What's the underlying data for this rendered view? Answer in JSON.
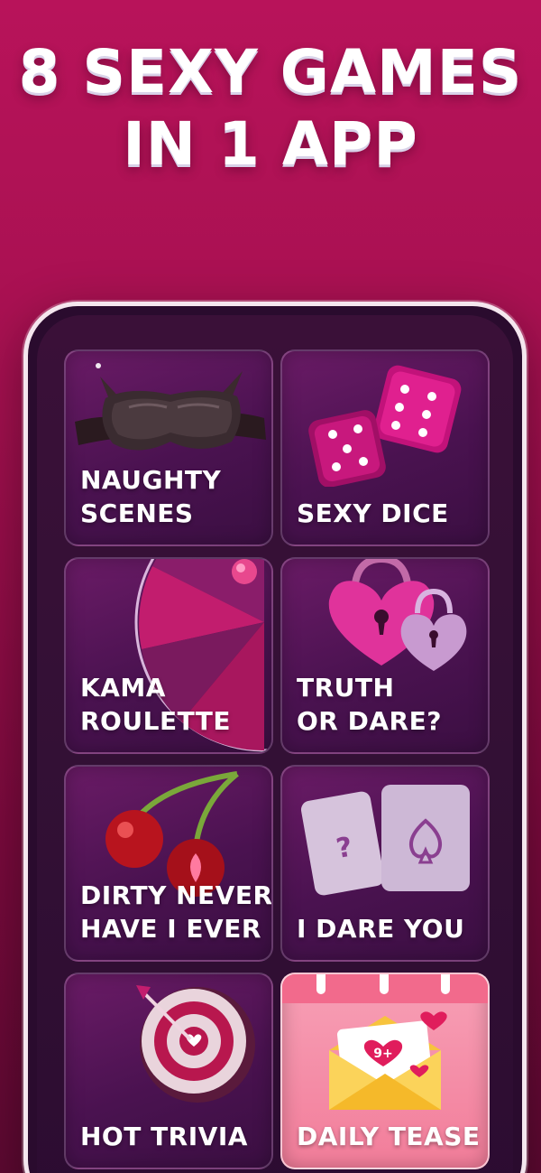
{
  "headline": {
    "line1": "8 SEXY GAMES",
    "line2": "IN 1 APP"
  },
  "games": [
    {
      "line1": "NAUGHTY",
      "line2": "SCENES",
      "icon": "sleep-mask-icon"
    },
    {
      "line1": "",
      "line2": "SEXY DICE",
      "icon": "dice-icon"
    },
    {
      "line1": "KAMA",
      "line2": "ROULETTE",
      "icon": "roulette-wheel-icon"
    },
    {
      "line1": "TRUTH",
      "line2": "OR DARE?",
      "icon": "heart-padlock-icon"
    },
    {
      "line1": "DIRTY NEVER",
      "line2": "HAVE I EVER",
      "icon": "cherries-icon"
    },
    {
      "line1": "",
      "line2": "I DARE YOU",
      "icon": "cards-icon"
    },
    {
      "line1": "",
      "line2": "HOT TRIVIA",
      "icon": "target-arrow-icon"
    },
    {
      "line1": "",
      "line2": "DAILY TEASE",
      "icon": "calendar-envelope-icon"
    }
  ],
  "badge": {
    "text": "9+"
  },
  "colors": {
    "background": "#b8135a",
    "card": "#5a1760",
    "card_highlight": "#f27d9a",
    "text": "#ffffff"
  }
}
